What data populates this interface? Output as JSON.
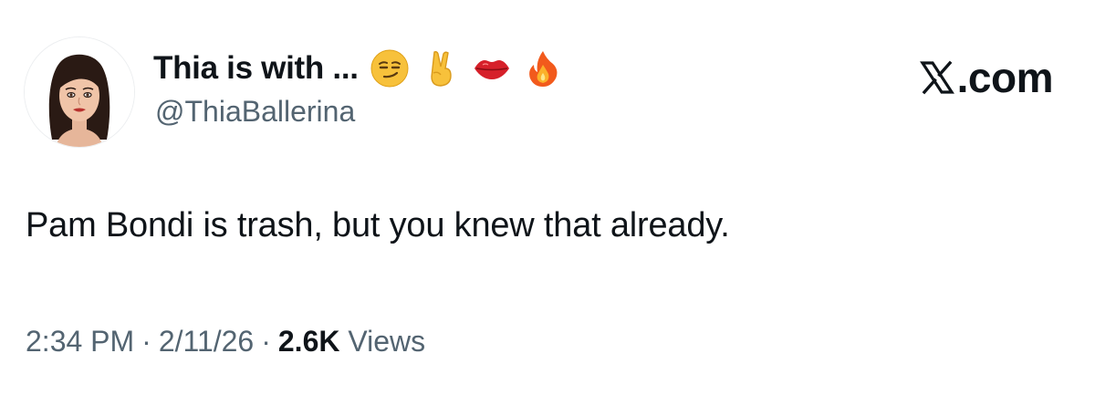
{
  "author": {
    "display_name": "Thia is with ...",
    "handle": "@ThiaBallerina",
    "name_emojis": [
      "smirk-emoji",
      "victory-hand-emoji",
      "lips-emoji",
      "fire-emoji"
    ]
  },
  "brand": {
    "label": ".com",
    "icon": "x-logo-icon"
  },
  "tweet": {
    "text": "Pam Bondi is trash, but you knew that already."
  },
  "meta": {
    "time": "2:34 PM",
    "separator": "·",
    "date": "2/11/26",
    "views_count": "2.6K",
    "views_label": "Views"
  },
  "colors": {
    "text_primary": "#0f1419",
    "text_secondary": "#536471",
    "background": "#ffffff"
  }
}
